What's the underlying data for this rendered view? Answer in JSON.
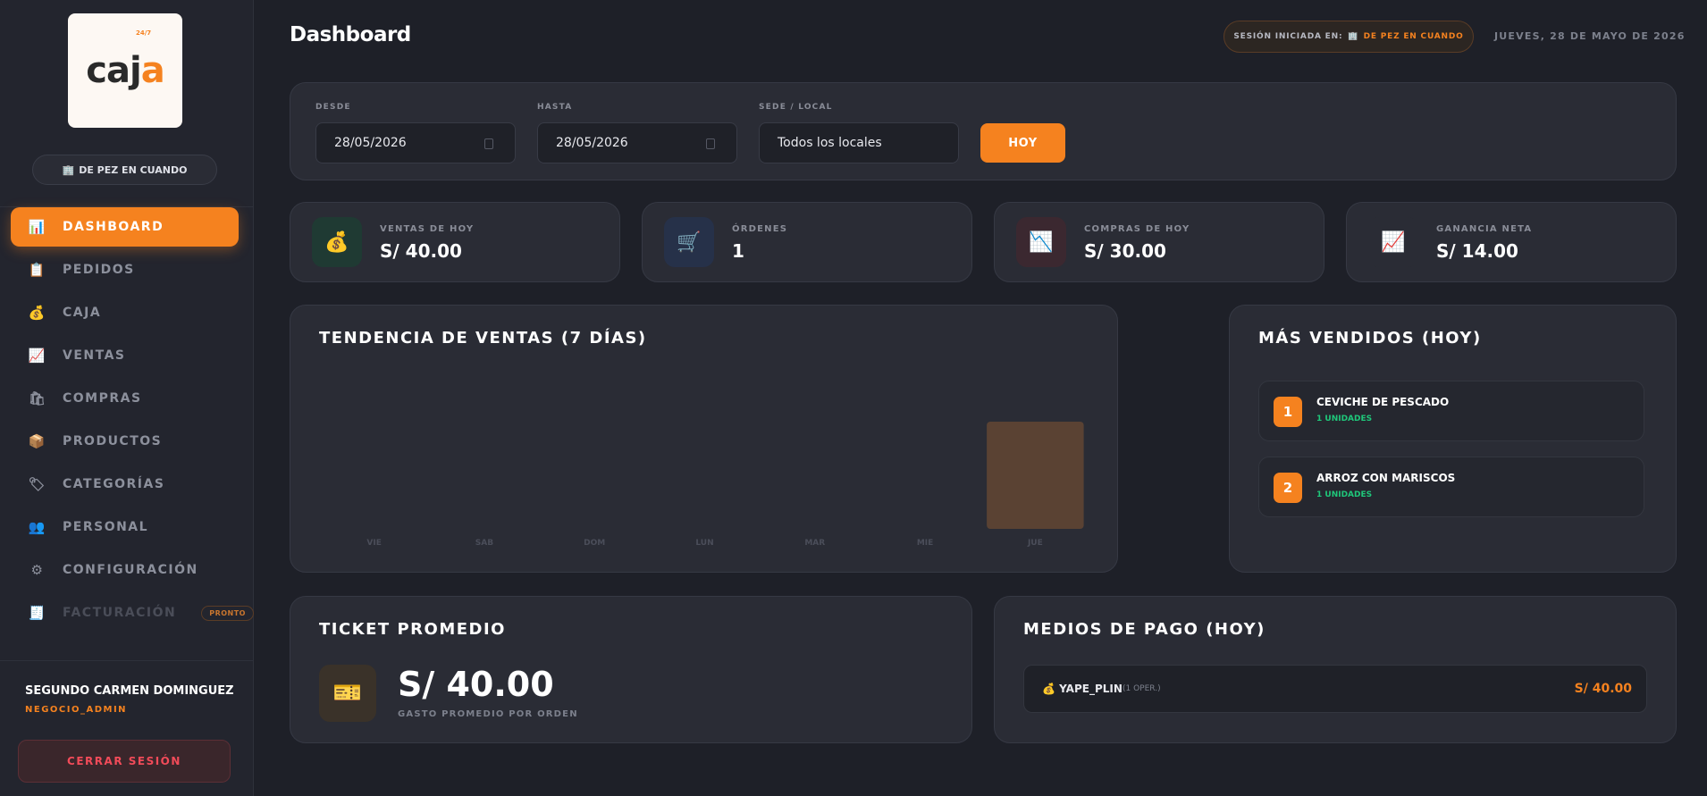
{
  "sidebar": {
    "logo": {
      "text_main": "caj",
      "text_accent": "a",
      "text_sub": "24/7"
    },
    "site_label": "DE PEZ EN CUANDO",
    "nav": [
      {
        "label": "DASHBOARD",
        "icon": "bar-chart-icon",
        "glyph": "📊",
        "active": true
      },
      {
        "label": "PEDIDOS",
        "icon": "clipboard-icon",
        "glyph": "📋"
      },
      {
        "label": "CAJA",
        "icon": "money-bag-icon",
        "glyph": "💰"
      },
      {
        "label": "VENTAS",
        "icon": "trend-up-icon",
        "glyph": "📈"
      },
      {
        "label": "COMPRAS",
        "icon": "shopping-bags-icon",
        "glyph": "🛍"
      },
      {
        "label": "PRODUCTOS",
        "icon": "package-icon",
        "glyph": "📦"
      },
      {
        "label": "CATEGORÍAS",
        "icon": "tag-icon",
        "glyph": "🏷"
      },
      {
        "label": "PERSONAL",
        "icon": "people-icon",
        "glyph": "👥"
      },
      {
        "label": "CONFIGURACIÓN",
        "icon": "gear-icon",
        "glyph": "⚙"
      },
      {
        "label": "FACTURACIÓN",
        "icon": "receipt-icon",
        "glyph": "🧾",
        "disabled": true,
        "badge": "PRONTO"
      }
    ],
    "user": {
      "name": "SEGUNDO CARMEN DOMINGUEZ",
      "role": "NEGOCIO_ADMIN"
    },
    "logout_label": "CERRAR SESIÓN"
  },
  "header": {
    "title": "Dashboard",
    "session_label": "SESIÓN INICIADA EN:",
    "session_value": "DE PEZ EN CUANDO",
    "date": "JUEVES, 28 DE MAYO DE 2026"
  },
  "filters": {
    "desde_label": "DESDE",
    "desde_value": "28/05/2026",
    "hasta_label": "HASTA",
    "hasta_value": "28/05/2026",
    "sede_label": "SEDE / LOCAL",
    "sede_value": "Todos los locales",
    "hoy_button": "HOY"
  },
  "kpis": [
    {
      "label": "VENTAS DE HOY",
      "value": "S/ 40.00",
      "icon": "money-bag-icon",
      "glyph": "💰",
      "color": "#1f3a33"
    },
    {
      "label": "ÓRDENES",
      "value": "1",
      "icon": "shopping-cart-icon",
      "glyph": "🛒",
      "color": "#263149"
    },
    {
      "label": "COMPRAS DE HOY",
      "value": "S/ 30.00",
      "icon": "trend-down-icon",
      "glyph": "📉",
      "color": "#3b2830"
    },
    {
      "label": "GANANCIA NETA",
      "value": "S/ 14.00",
      "icon": "trend-up-icon",
      "glyph": "📈",
      "color": "#2a2c35"
    }
  ],
  "trend": {
    "title": "TENDENCIA DE VENTAS (7 DÍAS)"
  },
  "chart_data": {
    "type": "bar",
    "title": "TENDENCIA DE VENTAS (7 DÍAS)",
    "categories": [
      "VIE",
      "SAB",
      "DOM",
      "LUN",
      "MAR",
      "MIE",
      "JUE"
    ],
    "values": [
      0,
      0,
      0,
      0,
      0,
      0,
      40
    ],
    "ylim": [
      0,
      40
    ],
    "grid": false,
    "bar_color": "#5a4233"
  },
  "best_sellers": {
    "title": "MÁS VENDIDOS (HOY)",
    "items": [
      {
        "rank": "1",
        "name": "CEVICHE DE PESCADO",
        "units": "1 UNIDADES"
      },
      {
        "rank": "2",
        "name": "ARROZ CON MARISCOS",
        "units": "1 UNIDADES"
      }
    ]
  },
  "ticket": {
    "title": "TICKET PROMEDIO",
    "value": "S/ 40.00",
    "subtitle": "GASTO PROMEDIO POR ORDEN",
    "icon": "ticket-icon",
    "glyph": "🎫"
  },
  "payments": {
    "title": "MEDIOS DE PAGO (HOY)",
    "items": [
      {
        "name": "YAPE_PLIN",
        "count": "(1 OPER.)",
        "amount": "S/ 40.00",
        "icon": "money-bag-icon",
        "glyph": "💰"
      }
    ]
  }
}
